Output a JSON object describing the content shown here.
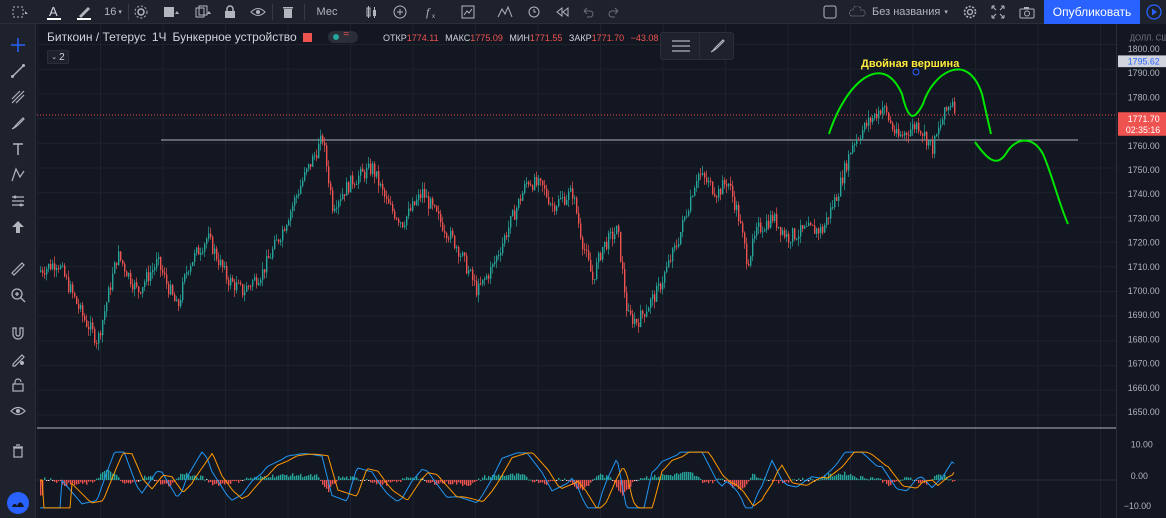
{
  "toolbar": {
    "font_size": "16",
    "interval_menu": "Мес",
    "layout_name": "Без названия",
    "publish_label": "Опубликовать"
  },
  "legend": {
    "symbol": "Биткоин / Тетерус",
    "interval": "1Ч",
    "exchange": "Бункерное устройство",
    "open_label": "ОТКР",
    "open_value": "1774.11",
    "high_label": "МАКС",
    "high_value": "1775.09",
    "low_label": "МИН",
    "low_value": "1771.55",
    "close_label": "ЗАКР",
    "close_value": "1771.70",
    "change_value": "−43.08",
    "collapse_count": "2"
  },
  "annotation": {
    "text": "Двойная вершина",
    "color": "#ffeb3b"
  },
  "price_axis": {
    "currency": "ДОЛЛ. СШ",
    "ticks": [
      "1800.00",
      "1790.00",
      "1780.00",
      "1770.00",
      "1760.00",
      "1750.00",
      "1740.00",
      "1730.00",
      "1720.00",
      "1710.00",
      "1700.00",
      "1690.00",
      "1680.00",
      "1670.00",
      "1660.00",
      "1650.00"
    ],
    "marker_high": "1795.62",
    "marker_price": "1771.70",
    "countdown": "02:35:16"
  },
  "osc_axis": {
    "ticks": [
      "10.00",
      "0.00",
      "−10.00"
    ]
  },
  "colors": {
    "up": "#26a69a",
    "down": "#ef5350",
    "accent": "#2962ff",
    "drawing": "#00e600",
    "background": "#131722"
  }
}
